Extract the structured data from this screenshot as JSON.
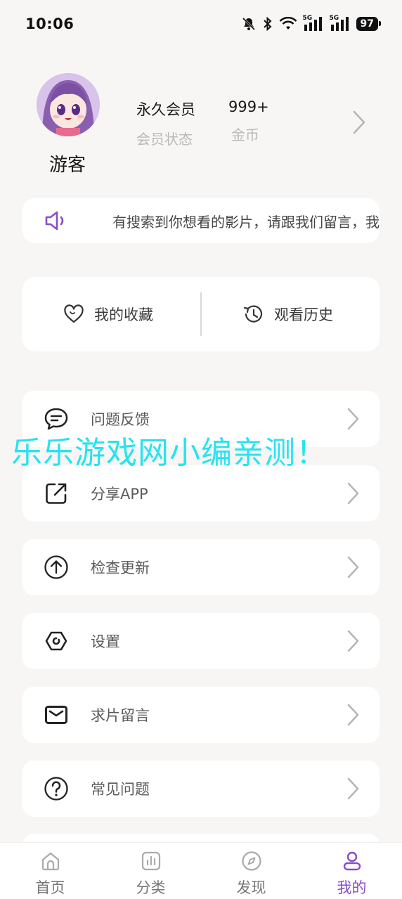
{
  "status_bar": {
    "time": "10:06",
    "battery": "97",
    "net1": "5G",
    "net2": "5G"
  },
  "profile": {
    "username": "游客",
    "vip_value": "永久会员",
    "vip_label": "会员状态",
    "coins_value": "999+",
    "coins_label": "金币",
    "avatar_icon": "anime-avatar-image"
  },
  "notice": {
    "icon": "speaker-icon",
    "text": "有搜索到你想看的影片，请跟我们留言，我"
  },
  "quick_actions": {
    "favorites": {
      "icon": "heart-icon",
      "label": "我的收藏"
    },
    "history": {
      "icon": "history-icon",
      "label": "观看历史"
    }
  },
  "menu": [
    {
      "icon": "message-icon",
      "label": "问题反馈"
    },
    {
      "icon": "share-icon",
      "label": "分享APP"
    },
    {
      "icon": "upload-icon",
      "label": "检查更新"
    },
    {
      "icon": "settings-icon",
      "label": "设置"
    },
    {
      "icon": "mail-icon",
      "label": "求片留言"
    },
    {
      "icon": "help-icon",
      "label": "常见问题"
    }
  ],
  "watermark": "乐乐游戏网小编亲测！",
  "tabbar": [
    {
      "icon": "home-icon",
      "label": "首页",
      "active": false
    },
    {
      "icon": "chart-icon",
      "label": "分类",
      "active": false
    },
    {
      "icon": "compass-icon",
      "label": "发现",
      "active": false
    },
    {
      "icon": "user-icon",
      "label": "我的",
      "active": true
    }
  ],
  "colors": {
    "accent": "#8a4cc9",
    "watermark": "#28e3ee",
    "background": "#f7f6f5"
  }
}
